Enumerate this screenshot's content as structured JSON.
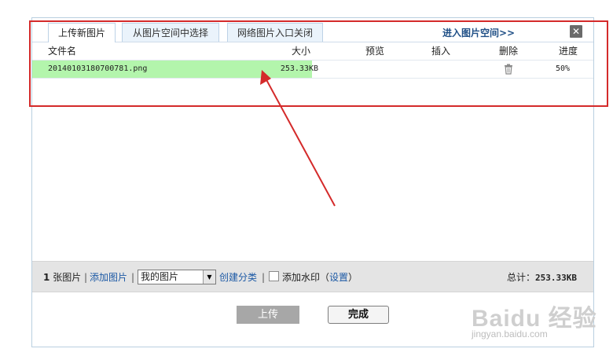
{
  "tabs": [
    {
      "label": "上传新图片"
    },
    {
      "label": "从图片空间中选择"
    },
    {
      "label": "网络图片入口关闭"
    }
  ],
  "header_link": "进入图片空间>>",
  "close_symbol": "✕",
  "columns": {
    "name": "文件名",
    "size": "大小",
    "preview": "预览",
    "insert": "插入",
    "delete": "删除",
    "progress": "进度"
  },
  "files": [
    {
      "name": "20140103180700781.png",
      "size": "253.33KB",
      "progress": "50%",
      "progress_value": 0.5
    }
  ],
  "bottom": {
    "count_num": "1",
    "count_text": "张图片",
    "add_link": "添加图片",
    "album_value": "我的图片",
    "create_category": "创建分类",
    "watermark_label": "添加水印（",
    "settings_link": "设置",
    "watermark_close": "）",
    "total_label": "总计：",
    "total_value": "253.33KB"
  },
  "buttons": {
    "upload": "上传",
    "done": "完成"
  },
  "colors": {
    "highlight_border": "#d42a2a",
    "progress_fill": "#b3f5ac",
    "link": "#1c59a5"
  },
  "watermark": {
    "logo": "Baidu 经验",
    "url": "jingyan.baidu.com"
  }
}
